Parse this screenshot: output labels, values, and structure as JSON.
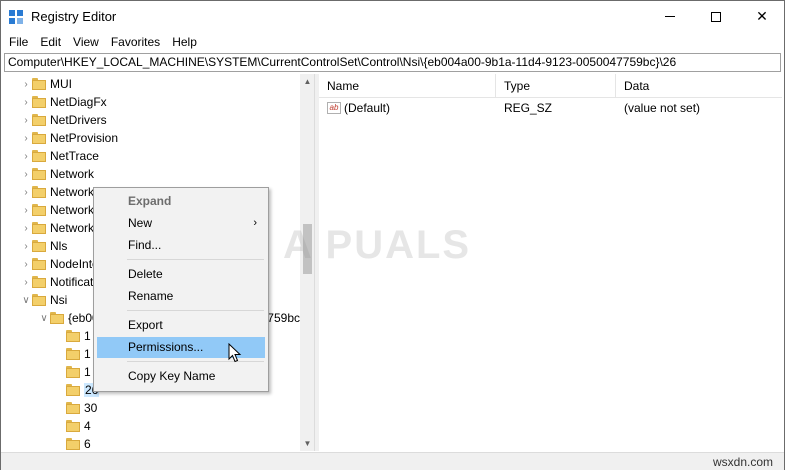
{
  "window": {
    "title": "Registry Editor",
    "minimize_glyph": "",
    "maximize_glyph": "",
    "close_glyph": "✕"
  },
  "menu": [
    "File",
    "Edit",
    "View",
    "Favorites",
    "Help"
  ],
  "address": "Computer\\HKEY_LOCAL_MACHINE\\SYSTEM\\CurrentControlSet\\Control\\Nsi\\{eb004a00-9b1a-11d4-9123-0050047759bc}\\26",
  "tree": {
    "items": [
      {
        "label": "MUI",
        "expander": "›"
      },
      {
        "label": "NetDiagFx",
        "expander": "›"
      },
      {
        "label": "NetDrivers",
        "expander": "›"
      },
      {
        "label": "NetProvision",
        "expander": "›"
      },
      {
        "label": "NetTrace",
        "expander": "›"
      },
      {
        "label": "Network",
        "expander": "›"
      },
      {
        "label": "NetworkProvider",
        "expander": "›"
      },
      {
        "label": "NetworkSetup2",
        "expander": "›"
      },
      {
        "label": "NetworkUxManager",
        "expander": "›"
      },
      {
        "label": "Nls",
        "expander": "›"
      },
      {
        "label": "NodeInterfaces",
        "expander": "›"
      },
      {
        "label": "Notifications",
        "expander": "›"
      },
      {
        "label": "Nsi",
        "expander": "∨"
      },
      {
        "label": "{eb004a00-9b1a-11d4-9123-0050047759bc}",
        "expander": "∨"
      },
      {
        "label": "1",
        "expander": ""
      },
      {
        "label": "1",
        "expander": ""
      },
      {
        "label": "1",
        "expander": ""
      },
      {
        "label": "26",
        "expander": ""
      },
      {
        "label": "30",
        "expander": ""
      },
      {
        "label": "4",
        "expander": ""
      },
      {
        "label": "6",
        "expander": ""
      }
    ],
    "scroll_up": "▲",
    "scroll_down": "▼"
  },
  "list": {
    "columns": [
      "Name",
      "Type",
      "Data"
    ],
    "rows": [
      {
        "icon": "ab",
        "name": "(Default)",
        "type": "REG_SZ",
        "data": "(value not set)"
      }
    ]
  },
  "context_menu": {
    "items": [
      {
        "label": "Expand",
        "disabled": true
      },
      {
        "label": "New",
        "submenu_arrow": "›"
      },
      {
        "label": "Find..."
      },
      {
        "label": "Delete"
      },
      {
        "label": "Rename"
      },
      {
        "label": "Export"
      },
      {
        "label": "Permissions...",
        "highlighted": true
      },
      {
        "label": "Copy Key Name"
      }
    ]
  },
  "watermark": "A PUALS",
  "site_mark": "wsxdn.com",
  "colors": {
    "highlight": "#91c9f7",
    "folder": "#f3cf6a",
    "selected_tree": "#cce8ff"
  }
}
